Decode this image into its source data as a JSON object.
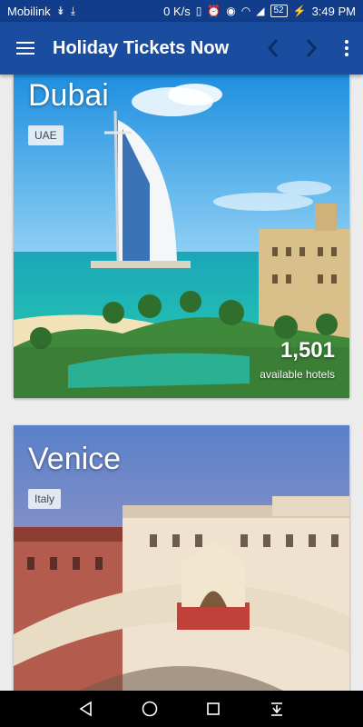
{
  "status_bar": {
    "carrier": "Mobilink",
    "speed": "0 K/s",
    "battery": "52",
    "time": "3:49 PM"
  },
  "app_bar": {
    "title": "Holiday Tickets Now"
  },
  "destinations": [
    {
      "city": "Dubai",
      "country": "UAE",
      "hotel_count": "1,501",
      "hotel_label": "available hotels"
    },
    {
      "city": "Venice",
      "country": "Italy"
    }
  ],
  "colors": {
    "status_bar": "#123d8a",
    "app_bar": "#1a4c9f",
    "background": "#ececec"
  },
  "icons": {
    "menu": "menu-icon",
    "back": "chevron-left-icon",
    "forward": "chevron-right-icon",
    "more": "more-vert-icon",
    "nav_back": "triangle-back-icon",
    "nav_home": "circle-home-icon",
    "nav_recent": "square-recent-icon",
    "nav_notifications": "pull-down-icon"
  }
}
